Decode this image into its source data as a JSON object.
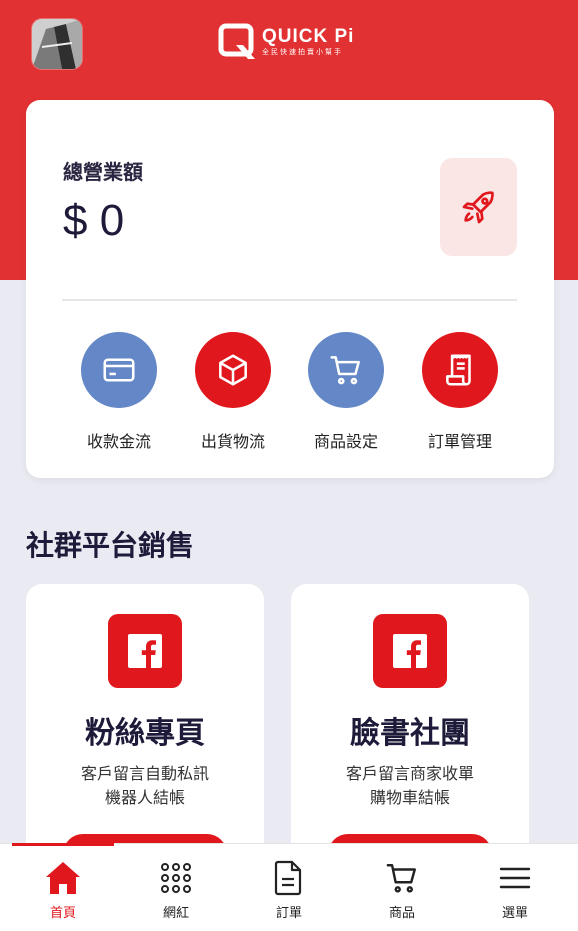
{
  "header": {
    "brand": "QUICK Pi",
    "tagline": "全民快速拍賣小幫手",
    "colors": {
      "primary": "#e23132",
      "accent_blue": "#6387c7"
    }
  },
  "revenue": {
    "label": "總營業額",
    "value": "$ 0",
    "action_icon": "rocket-icon"
  },
  "quick_actions": [
    {
      "label": "收款金流",
      "icon": "credit-card-icon",
      "color": "blue"
    },
    {
      "label": "出貨物流",
      "icon": "box-icon",
      "color": "red"
    },
    {
      "label": "商品設定",
      "icon": "cart-icon",
      "color": "blue"
    },
    {
      "label": "訂單管理",
      "icon": "receipt-icon",
      "color": "red"
    }
  ],
  "social": {
    "title": "社群平台銷售",
    "cards": [
      {
        "title": "粉絲專頁",
        "line1": "客戶留言自動私訊",
        "line2": "機器人結帳",
        "icon": "facebook-icon"
      },
      {
        "title": "臉書社團",
        "line1": "客戶留言商家收單",
        "line2": "購物車結帳",
        "icon": "facebook-icon"
      }
    ]
  },
  "tabbar": {
    "active": "首頁",
    "tabs": [
      {
        "label": "首頁",
        "icon": "home-icon"
      },
      {
        "label": "網紅",
        "icon": "grid-dots-icon"
      },
      {
        "label": "訂單",
        "icon": "document-icon"
      },
      {
        "label": "商品",
        "icon": "cart-icon"
      },
      {
        "label": "選單",
        "icon": "hamburger-menu-icon"
      }
    ]
  }
}
